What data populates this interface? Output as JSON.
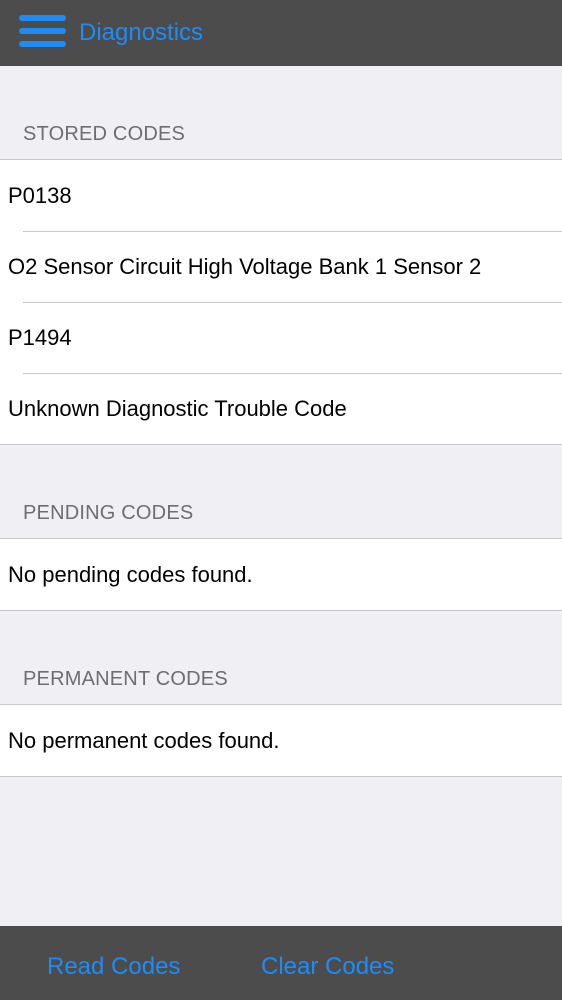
{
  "navbar": {
    "menu_icon": "hamburger-menu-icon",
    "title": "Diagnostics",
    "accent_color": "#1e8cf6",
    "bar_color": "#4c4c4c"
  },
  "sections": {
    "stored": {
      "header": "STORED CODES",
      "rows": [
        "P0138",
        "O2 Sensor Circuit High Voltage Bank 1 Sensor 2",
        "P1494",
        "Unknown Diagnostic Trouble Code"
      ]
    },
    "pending": {
      "header": "PENDING CODES",
      "rows": [
        "No pending codes found."
      ]
    },
    "permanent": {
      "header": "PERMANENT CODES",
      "rows": [
        "No permanent codes found."
      ]
    }
  },
  "toolbar": {
    "read_label": "Read Codes",
    "clear_label": "Clear Codes"
  }
}
